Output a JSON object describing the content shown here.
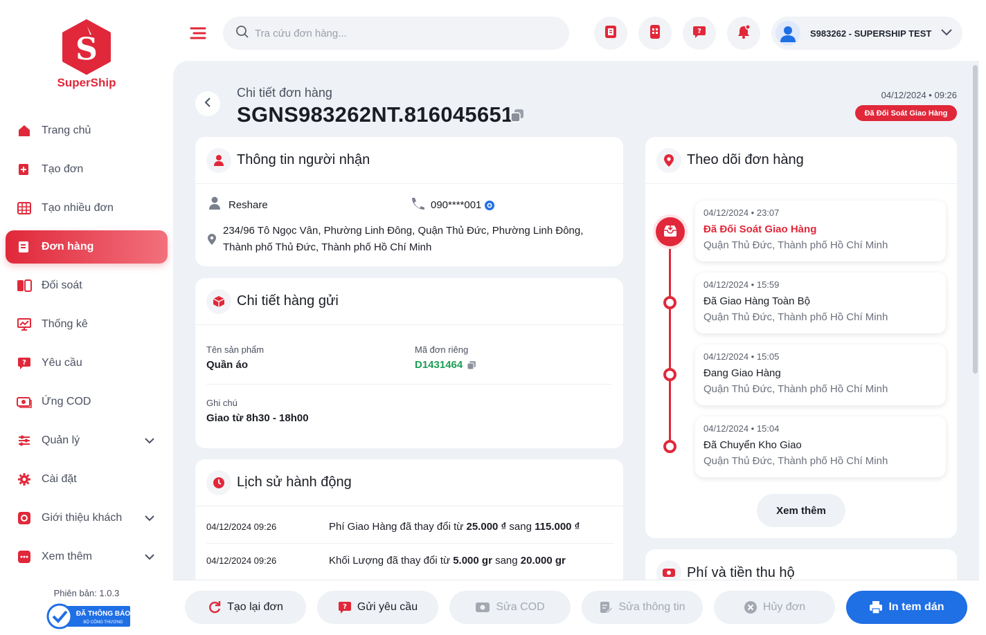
{
  "brand": {
    "name": "SuperShip"
  },
  "sidebar": {
    "items": [
      {
        "label": "Trang chủ",
        "active": false
      },
      {
        "label": "Tạo đơn",
        "active": false
      },
      {
        "label": "Tạo nhiều đơn",
        "active": false
      },
      {
        "label": "Đơn hàng",
        "active": true
      },
      {
        "label": "Đối soát",
        "active": false
      },
      {
        "label": "Thống kê",
        "active": false
      },
      {
        "label": "Yêu cầu",
        "active": false
      },
      {
        "label": "Ứng COD",
        "active": false
      },
      {
        "label": "Quản lý",
        "active": false,
        "expandable": true
      },
      {
        "label": "Cài đặt",
        "active": false
      },
      {
        "label": "Giới thiệu khách",
        "active": false,
        "expandable": true
      },
      {
        "label": "Xem thêm",
        "active": false,
        "expandable": true
      }
    ],
    "version": "Phiên bản: 1.0.3",
    "gov_badge": {
      "line1": "ĐÃ THÔNG BÁO",
      "line2": "BỘ CÔNG THƯƠNG"
    }
  },
  "topbar": {
    "search_placeholder": "Tra cứu đơn hàng...",
    "user": "S983262 - SUPERSHIP TEST"
  },
  "header": {
    "subtitle": "Chi tiết đơn hàng",
    "order_code": "SGNS983262NT.816045651",
    "datetime": "04/12/2024 • 09:26",
    "status": "Đã Đối Soát Giao Hàng"
  },
  "recipient": {
    "title": "Thông tin người nhận",
    "name": "Reshare",
    "phone": "090****001",
    "address_line1": "234/96 Tô Ngọc Vân, Phường Linh Đông, Quận Thủ Đức, Phường Linh Đông,",
    "address_line2": "Thành phố Thủ Đức, Thành phố Hồ Chí Minh"
  },
  "goods": {
    "title": "Chi tiết hàng gửi",
    "product_label": "Tên sản phẩm",
    "product_value": "Quần áo",
    "code_label": "Mã đơn riêng",
    "code_value": "D1431464",
    "note_label": "Ghi chú",
    "note_value": "Giao từ 8h30 - 18h00"
  },
  "history": {
    "title": "Lịch sử hành động",
    "rows": [
      {
        "date": "04/12/2024 09:26",
        "pre": "Phí Giao Hàng đã thay đổi từ ",
        "from": "25.000 ₫",
        "mid": " sang ",
        "to": "115.000 ₫"
      },
      {
        "date": "04/12/2024 09:26",
        "pre": "Khối Lượng đã thay đổi từ ",
        "from": "5.000 gr",
        "mid": " sang ",
        "to": "20.000 gr"
      }
    ]
  },
  "tracking": {
    "title": "Theo dõi đơn hàng",
    "events": [
      {
        "time": "04/12/2024 • 23:07",
        "status": "Đã Đối Soát Giao Hàng",
        "location": "Quận Thủ Đức, Thành phố Hồ Chí Minh",
        "highlight": true
      },
      {
        "time": "04/12/2024 • 15:59",
        "status": "Đã Giao Hàng Toàn Bộ",
        "location": "Quận Thủ Đức, Thành phố Hồ Chí Minh",
        "highlight": false
      },
      {
        "time": "04/12/2024 • 15:05",
        "status": "Đang Giao Hàng",
        "location": "Quận Thủ Đức, Thành phố Hồ Chí Minh",
        "highlight": false
      },
      {
        "time": "04/12/2024 • 15:04",
        "status": "Đã Chuyển Kho Giao",
        "location": "Quận Thủ Đức, Thành phố Hồ Chí Minh",
        "highlight": false
      }
    ],
    "more_label": "Xem thêm"
  },
  "fees": {
    "title": "Phí và tiền thu hộ"
  },
  "actions": {
    "recreate": "Tạo lại đơn",
    "request": "Gửi yêu cầu",
    "edit_cod": "Sửa COD",
    "edit_info": "Sửa thông tin",
    "cancel": "Hủy đơn",
    "print": "In tem dán"
  },
  "colors": {
    "brand_red": "#e0283a",
    "primary_blue": "#1f6fe5",
    "code_green": "#1f9d55"
  }
}
